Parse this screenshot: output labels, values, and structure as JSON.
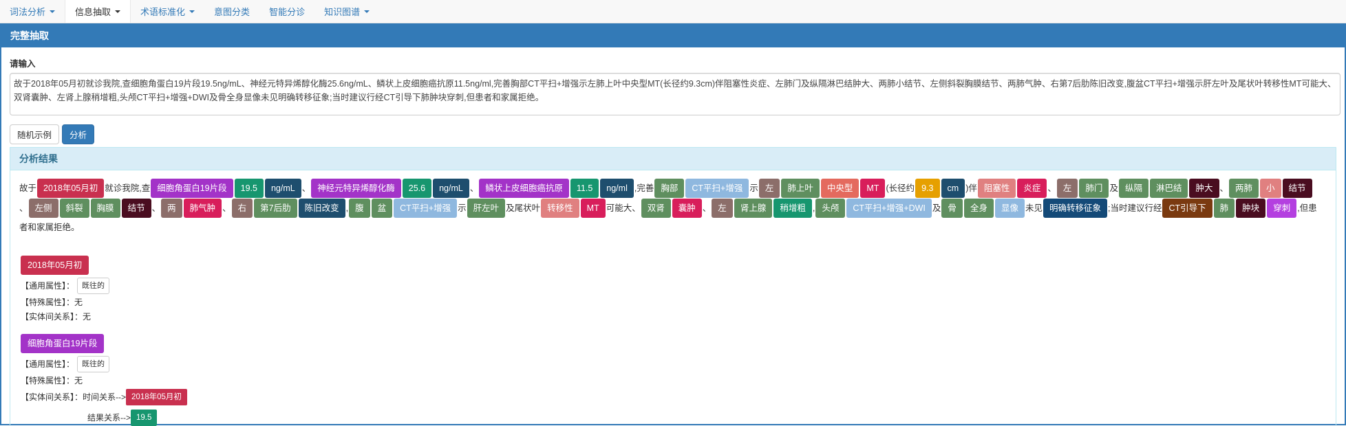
{
  "nav": [
    {
      "label": "词法分析",
      "caret": true,
      "active": false
    },
    {
      "label": "信息抽取",
      "caret": true,
      "active": true
    },
    {
      "label": "术语标准化",
      "caret": true,
      "active": false
    },
    {
      "label": "意图分类",
      "caret": false,
      "active": false
    },
    {
      "label": "智能分诊",
      "caret": false,
      "active": false
    },
    {
      "label": "知识图谱",
      "caret": true,
      "active": false
    }
  ],
  "panel_title": "完整抽取",
  "input_label": "请输入",
  "input_value": "故于2018年05月初就诊我院,查细胞角蛋白19片段19.5ng/mL、神经元特异烯醇化酶25.6ng/mL、鳞状上皮细胞癌抗原11.5ng/ml,完善胸部CT平扫+增强示左肺上叶中央型MT(长径约9.3cm)伴阻塞性炎症、左肺门及纵隔淋巴结肿大、两肺小结节、左侧斜裂胸膜结节、两肺气肿、右第7后肋陈旧改变,腹盆CT平扫+增强示肝左叶及尾状叶转移性MT可能大、双肾囊肿、左肾上腺稍增粗,头颅CT平扫+增强+DWI及骨全身显像未见明确转移征象;当时建议行经CT引导下肺肿块穿刺,但患者和家属拒绝。",
  "buttons": {
    "random": "随机示例",
    "analyze": "分析"
  },
  "result_title": "分析结果",
  "colors": {
    "time": "#c9304f",
    "exam": "#a333c8",
    "num": "#17966f",
    "unit": "#1e4e6e",
    "body": "#5f8f5f",
    "exam2": "#8fb8df",
    "side": "#8c6e6a",
    "dis": "#d74860",
    "sev": "#e08080",
    "mt": "#d81e5b",
    "sym": "#4a0d20",
    "num2": "#e6a000",
    "neg": "#144a78",
    "op": "#7a3a10",
    "act": "#b440e0",
    "fc": "#e46a5e"
  },
  "segments": [
    {
      "t": "故于"
    },
    {
      "t": "2018年05月初",
      "c": "time"
    },
    {
      "t": "就诊我院,查"
    },
    {
      "t": "细胞角蛋白19片段",
      "c": "exam"
    },
    {
      "t": "19.5",
      "c": "num"
    },
    {
      "t": "ng/mL",
      "c": "unit"
    },
    {
      "t": "、"
    },
    {
      "t": "神经元特异烯醇化酶",
      "c": "exam"
    },
    {
      "t": "25.6",
      "c": "num"
    },
    {
      "t": "ng/mL",
      "c": "unit"
    },
    {
      "t": "、"
    },
    {
      "t": "鳞状上皮细胞癌抗原",
      "c": "exam"
    },
    {
      "t": "11.5",
      "c": "num"
    },
    {
      "t": "ng/ml",
      "c": "unit"
    },
    {
      "t": ",完善"
    },
    {
      "t": "胸部",
      "c": "body"
    },
    {
      "t": "CT平扫+增强",
      "c": "exam2"
    },
    {
      "t": "示"
    },
    {
      "t": "左",
      "c": "side"
    },
    {
      "t": "肺上叶",
      "c": "body"
    },
    {
      "t": "中央型",
      "c": "fc"
    },
    {
      "t": "MT",
      "c": "mt"
    },
    {
      "t": "(长径约"
    },
    {
      "t": "9.3",
      "c": "num2"
    },
    {
      "t": "cm",
      "c": "unit"
    },
    {
      "t": ")伴"
    },
    {
      "t": "阻塞性",
      "c": "sev"
    },
    {
      "t": "炎症",
      "c": "mt"
    },
    {
      "t": "、"
    },
    {
      "t": "左",
      "c": "side"
    },
    {
      "t": "肺门",
      "c": "body"
    },
    {
      "t": "及"
    },
    {
      "t": "纵隔",
      "c": "body"
    },
    {
      "t": "淋巴结",
      "c": "body"
    },
    {
      "t": "肿大",
      "c": "sym"
    },
    {
      "t": "、"
    },
    {
      "t": "两肺",
      "c": "body"
    },
    {
      "t": "小",
      "c": "sev"
    },
    {
      "t": "结节",
      "c": "sym"
    },
    {
      "t": "、"
    },
    {
      "t": "左侧",
      "c": "side"
    },
    {
      "t": "斜裂",
      "c": "body"
    },
    {
      "t": "胸膜",
      "c": "body"
    },
    {
      "t": "结节",
      "c": "sym"
    },
    {
      "t": "、"
    },
    {
      "t": "两",
      "c": "side"
    },
    {
      "t": "肺气肿",
      "c": "mt"
    },
    {
      "t": "、"
    },
    {
      "t": "右",
      "c": "side"
    },
    {
      "t": "第7后肋",
      "c": "body"
    },
    {
      "t": "陈旧改变",
      "c": "unit"
    },
    {
      "t": ","
    },
    {
      "t": "腹",
      "c": "body"
    },
    {
      "t": "盆",
      "c": "body"
    },
    {
      "t": "CT平扫+增强",
      "c": "exam2"
    },
    {
      "t": "示"
    },
    {
      "t": "肝左叶",
      "c": "body"
    },
    {
      "t": "及尾状叶"
    },
    {
      "t": "转移性",
      "c": "sev"
    },
    {
      "t": "MT",
      "c": "mt"
    },
    {
      "t": "可能大、"
    },
    {
      "t": "双肾",
      "c": "body"
    },
    {
      "t": "囊肿",
      "c": "mt"
    },
    {
      "t": "、"
    },
    {
      "t": "左",
      "c": "side"
    },
    {
      "t": "肾上腺",
      "c": "body"
    },
    {
      "t": "稍增粗",
      "c": "num"
    },
    {
      "t": ","
    },
    {
      "t": "头颅",
      "c": "body"
    },
    {
      "t": "CT平扫+增强+DWI",
      "c": "exam2"
    },
    {
      "t": "及"
    },
    {
      "t": "骨",
      "c": "body"
    },
    {
      "t": "全身",
      "c": "body"
    },
    {
      "t": "显像",
      "c": "exam2"
    },
    {
      "t": "未见"
    },
    {
      "t": "明确转移征象",
      "c": "neg"
    },
    {
      "t": ";当时建议行经"
    },
    {
      "t": "CT引导下",
      "c": "op"
    },
    {
      "t": "肺",
      "c": "body"
    },
    {
      "t": "肿块",
      "c": "sym"
    },
    {
      "t": "穿刺",
      "c": "act"
    },
    {
      "t": ",但患者和家属拒绝。"
    }
  ],
  "entities": [
    {
      "name": "2018年05月初",
      "color": "#c9304f",
      "general_label": "【通用属性】：",
      "general_value": "既往的",
      "special_label": "【特殊属性】：",
      "special_value": "无",
      "rel_label": "【实体间关系】：",
      "relations_text": "无",
      "relations": []
    },
    {
      "name": "细胞角蛋白19片段",
      "color": "#a333c8",
      "general_label": "【通用属性】：",
      "general_value": "既往的",
      "special_label": "【特殊属性】：",
      "special_value": "无",
      "rel_label": "【实体间关系】：",
      "relations_text": "",
      "relations": [
        {
          "label": "时间关系-->",
          "target": "2018年05月初",
          "color": "#c9304f"
        },
        {
          "label": "结果关系-->",
          "target": "19.5",
          "color": "#17966f"
        }
      ]
    }
  ]
}
